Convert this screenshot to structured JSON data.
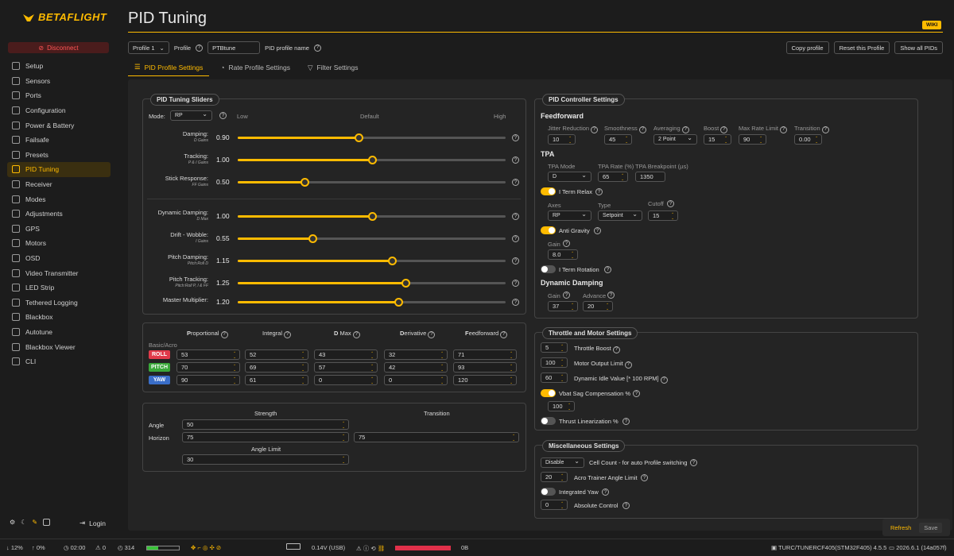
{
  "app": {
    "brand": "BETAFLIGHT",
    "disconnect": "Disconnect",
    "login": "Login"
  },
  "nav": [
    "Setup",
    "Sensors",
    "Ports",
    "Configuration",
    "Power & Battery",
    "Failsafe",
    "Presets",
    "PID Tuning",
    "Receiver",
    "Modes",
    "Adjustments",
    "GPS",
    "Motors",
    "OSD",
    "Video Transmitter",
    "LED Strip",
    "Tethered Logging",
    "Blackbox",
    "Autotune",
    "Blackbox Viewer",
    "CLI"
  ],
  "page": {
    "title": "PID Tuning",
    "wiki": "WIKI"
  },
  "toolbar": {
    "profile_select": "Profile 1",
    "profile_label": "Profile",
    "profile_name": "PTBtune",
    "profile_name_label": "PID profile name",
    "copy": "Copy profile",
    "reset": "Reset this Profile",
    "show_all": "Show all PIDs"
  },
  "tabs": [
    "PID Profile Settings",
    "Rate Profile Settings",
    "Filter Settings"
  ],
  "sliders": {
    "legend": "PID Tuning Sliders",
    "mode_label": "Mode:",
    "mode": "RP",
    "low": "Low",
    "default": "Default",
    "high": "High",
    "rows": [
      {
        "label": "Damping:",
        "sub": "D Gains",
        "value": "0.90",
        "level": 0.45
      },
      {
        "label": "Tracking:",
        "sub": "P & I Gains",
        "value": "1.00",
        "level": 0.5
      },
      {
        "label": "Stick Response:",
        "sub": "FF Gains",
        "value": "0.50",
        "level": 0.25
      },
      {
        "label": "Dynamic Damping:",
        "sub": "D Max",
        "value": "1.00",
        "level": 0.5
      },
      {
        "label": "Drift - Wobble:",
        "sub": "I Gains",
        "value": "0.55",
        "level": 0.28
      },
      {
        "label": "Pitch Damping:",
        "sub": "Pitch:Roll D",
        "value": "1.15",
        "level": 0.575
      },
      {
        "label": "Pitch Tracking:",
        "sub": "Pitch:Roll P, I & FF",
        "value": "1.25",
        "level": 0.625
      },
      {
        "label": "Master Multiplier:",
        "sub": "",
        "value": "1.20",
        "level": 0.6
      }
    ]
  },
  "pid_table": {
    "headers": [
      {
        "bold": "P",
        "rest": "roportional"
      },
      {
        "bold": "",
        "rest": "Integral"
      },
      {
        "bold": "D",
        "rest": " Max"
      },
      {
        "bold": "D",
        "rest": "erivative"
      },
      {
        "bold": "F",
        "rest": "eedforward"
      }
    ],
    "basic": "Basic/Acro",
    "rows": [
      {
        "axis": "ROLL",
        "color": "#e03a4a",
        "vals": [
          "53",
          "52",
          "43",
          "32",
          "71"
        ]
      },
      {
        "axis": "PITCH",
        "color": "#3aa83a",
        "vals": [
          "70",
          "69",
          "57",
          "42",
          "93"
        ]
      },
      {
        "axis": "YAW",
        "color": "#3a6ec8",
        "vals": [
          "90",
          "61",
          "0",
          "0",
          "120"
        ]
      }
    ]
  },
  "angle": {
    "strength": "Strength",
    "transition": "Transition",
    "angle": "Angle",
    "angle_val": "50",
    "horizon": "Horizon",
    "horizon_val": "75",
    "horizon_trans": "75",
    "limit_label": "Angle Limit",
    "limit_val": "30"
  },
  "pidctrl": {
    "legend": "PID Controller Settings",
    "feedforward": "Feedforward",
    "ff_cols": [
      {
        "label": "Jitter Reduction",
        "val": "10"
      },
      {
        "label": "Smoothness",
        "val": "45"
      },
      {
        "label": "Averaging",
        "val": "2 Point"
      },
      {
        "label": "Boost",
        "val": "15"
      },
      {
        "label": "Max Rate Limit",
        "val": "90"
      },
      {
        "label": "Transition",
        "val": "0.00"
      }
    ],
    "tpa": "TPA",
    "tpa_mode_label": "TPA Mode",
    "tpa_mode": "D",
    "tpa_rate_label": "TPA Rate (%)",
    "tpa_rate": "65",
    "tpa_bp_label": "TPA Breakpoint (µs)",
    "tpa_bp": "1350",
    "iterm_relax": "I Term Relax",
    "axes_label": "Axes",
    "axes": "RP",
    "type_label": "Type",
    "type": "Setpoint",
    "cutoff_label": "Cutoff",
    "cutoff": "15",
    "anti_gravity": "Anti Gravity",
    "gain_label": "Gain",
    "gain": "8.0",
    "iterm_rotation": "I Term Rotation",
    "dyn_damping": "Dynamic Damping",
    "dd_gain_label": "Gain",
    "dd_gain": "37",
    "dd_adv_label": "Advance",
    "dd_adv": "20"
  },
  "throttle": {
    "legend": "Throttle and Motor Settings",
    "rows": [
      {
        "val": "5",
        "label": "Throttle Boost"
      },
      {
        "val": "100",
        "label": "Motor Output Limit"
      },
      {
        "val": "60",
        "label": "Dynamic Idle Value [* 100 RPM]"
      }
    ],
    "vbat": "Vbat Sag Compensation %",
    "vbat_val": "100",
    "thrust": "Thrust Linearization %"
  },
  "misc": {
    "legend": "Miscellaneous Settings",
    "cell": "Disable",
    "cell_label": "Cell Count - for auto Profile switching",
    "acro_val": "20",
    "acro_label": "Acro Trainer Angle Limit",
    "integrated_yaw": "Integrated Yaw",
    "abs_val": "0",
    "abs_label": "Absolute Control"
  },
  "actions": {
    "refresh": "Refresh",
    "save": "Save"
  },
  "status": {
    "a": "12%",
    "b": "0%",
    "time": "02:00",
    "warn": "0",
    "cnt": "314",
    "volt": "0.14V (USB)",
    "mem": "0B",
    "fc": "TURC/TUNERCF405(STM32F405) 4.5.5",
    "ver": "2026.6.1 (14a057f)"
  }
}
